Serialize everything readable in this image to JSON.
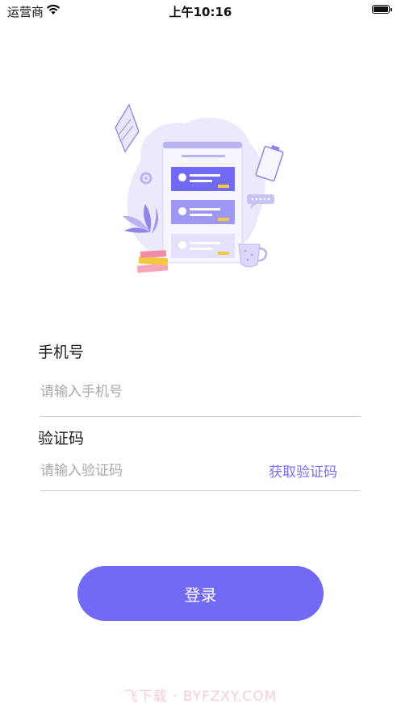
{
  "status_bar": {
    "carrier": "运营商",
    "time": "上午10:16",
    "wifi_icon": "wifi-icon",
    "battery_icon": "battery-icon"
  },
  "illustration": {
    "icon": "message-list-illustration",
    "accent_color": "#7269f5",
    "highlight_color": "#f5c842"
  },
  "form": {
    "phone_label": "手机号",
    "phone_placeholder": "请输入手机号",
    "phone_value": "",
    "code_label": "验证码",
    "code_placeholder": "请输入验证码",
    "code_value": "",
    "get_code_label": "获取验证码"
  },
  "login_button_label": "登录",
  "watermark": "飞下载 · BYFZXY.COM",
  "colors": {
    "primary": "#7269f5",
    "link": "#7b6ff1",
    "divider": "#cfcfcf"
  }
}
